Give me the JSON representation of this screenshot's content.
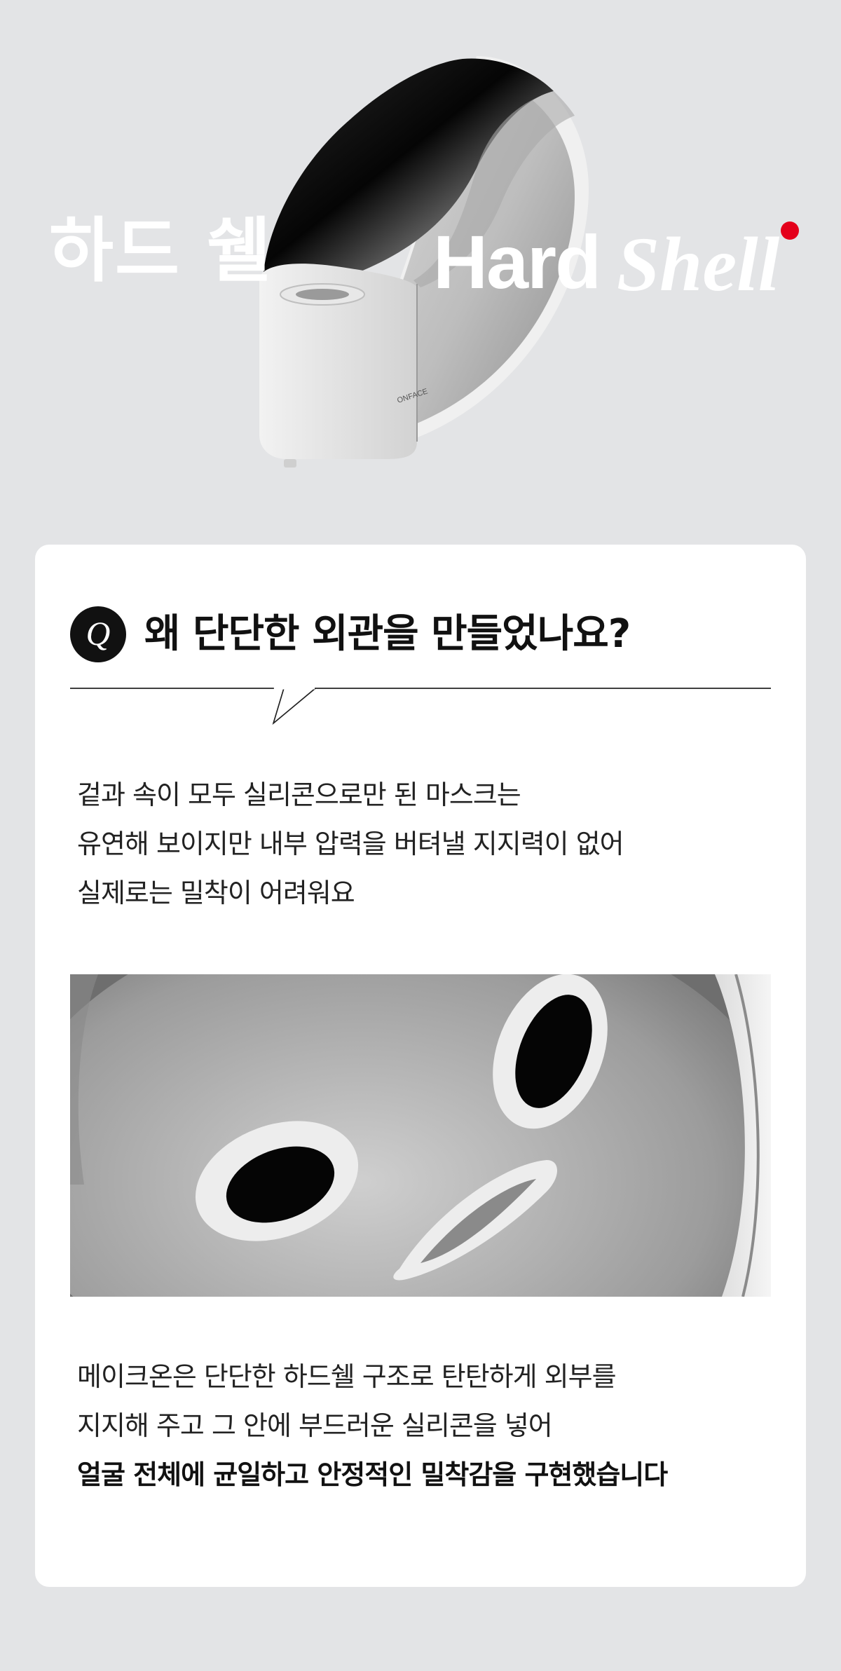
{
  "hero": {
    "title_kr": "하드 쉘",
    "title_en_regular": "Hard",
    "title_en_italic": "Shell",
    "device_brand": "ONFACE",
    "accent_color": "#e4001b"
  },
  "qa": {
    "badge": "Q",
    "question": "왜 단단한 외관을 만들었나요?",
    "paragraph1": [
      "겉과 속이 모두 실리콘으로만 된 마스크는",
      "유연해 보이지만 내부 압력을 버텨낼 지지력이 없어",
      "실제로는 밀착이 어려워요"
    ],
    "paragraph2": [
      "메이크온은 단단한 하드쉘 구조로 탄탄하게 외부를",
      "지지해 주고 그 안에 부드러운 실리콘을 넣어"
    ],
    "paragraph2_strong": "얼굴 전체에 균일하고 안정적인 밀착감을 구현했습니다"
  }
}
